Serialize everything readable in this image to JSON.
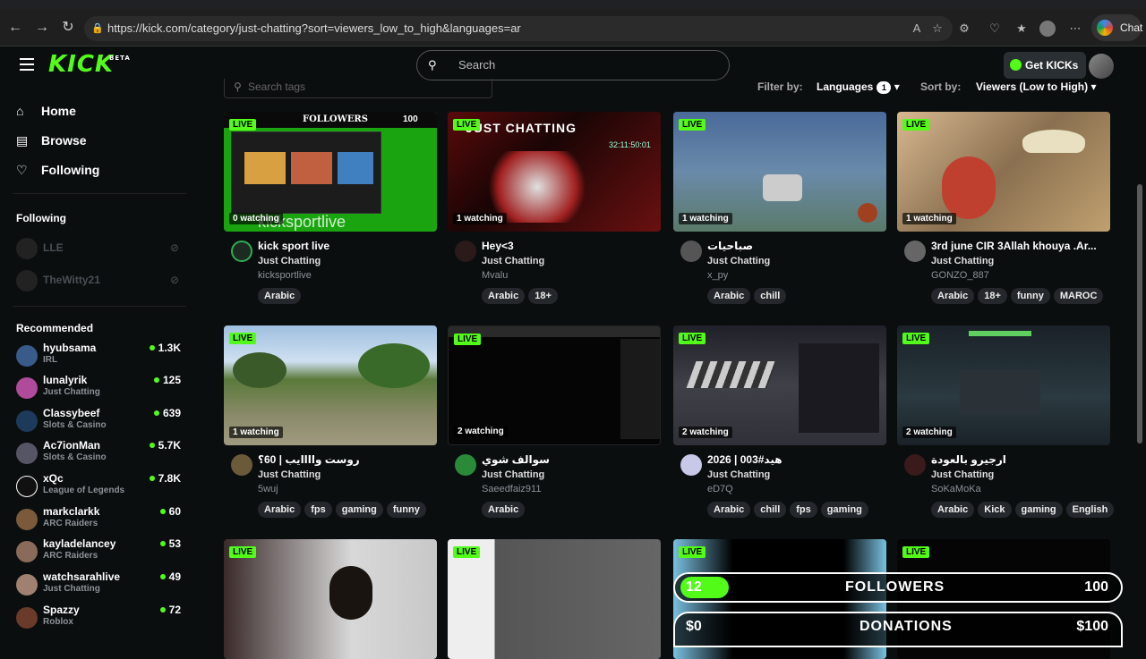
{
  "browser": {
    "url": "https://kick.com/category/just-chatting?sort=viewers_low_to_high&languages=ar",
    "chat_label": "Chat"
  },
  "header": {
    "logo": "KICK",
    "logo_beta": "BETA",
    "search_placeholder": "Search",
    "get_kicks": "Get KICKs"
  },
  "sidebar": {
    "nav": [
      "Home",
      "Browse",
      "Following"
    ],
    "following_title": "Following",
    "following": [
      "LLE",
      "TheWitty21"
    ],
    "recommended_title": "Recommended",
    "recommended": [
      {
        "name": "hyubsama",
        "cat": "IRL",
        "viewers": "1.3K"
      },
      {
        "name": "lunalyrik",
        "cat": "Just Chatting",
        "viewers": "125"
      },
      {
        "name": "Classybeef",
        "cat": "Slots & Casino",
        "viewers": "639"
      },
      {
        "name": "Ac7ionMan",
        "cat": "Slots & Casino",
        "viewers": "5.7K"
      },
      {
        "name": "xQc",
        "cat": "League of Legends",
        "viewers": "7.8K"
      },
      {
        "name": "markclarkk",
        "cat": "ARC Raiders",
        "viewers": "60"
      },
      {
        "name": "kayladelancey",
        "cat": "ARC Raiders",
        "viewers": "53"
      },
      {
        "name": "watchsarahlive",
        "cat": "Just Chatting",
        "viewers": "49"
      },
      {
        "name": "Spazzy",
        "cat": "Roblox",
        "viewers": "72"
      }
    ]
  },
  "filters": {
    "tag_search_placeholder": "Search tags",
    "filter_by": "Filter by:",
    "languages": "Languages",
    "languages_count": "1",
    "sort_by": "Sort by:",
    "sort_value": "Viewers (Low to High)"
  },
  "common": {
    "live": "LIVE"
  },
  "cards": [
    {
      "title": "kick sport live",
      "cat": "Just Chatting",
      "user": "kicksportlive",
      "watching": "0 watching",
      "tags": [
        "Arabic"
      ]
    },
    {
      "title": "Hey<3",
      "cat": "Just Chatting",
      "user": "Mvalu",
      "watching": "1 watching",
      "tags": [
        "Arabic",
        "18+"
      ]
    },
    {
      "title": "صباحيات",
      "cat": "Just Chatting",
      "user": "x_py",
      "watching": "1 watching",
      "tags": [
        "Arabic",
        "chill"
      ]
    },
    {
      "title": "3rd june CIR 3Allah khouya .Ar...",
      "cat": "Just Chatting",
      "user": "GONZO_887",
      "watching": "1 watching",
      "tags": [
        "Arabic",
        "18+",
        "funny",
        "MAROC"
      ]
    },
    {
      "title": "روست واااايب | 60؟",
      "cat": "Just Chatting",
      "user": "5wuj",
      "watching": "1 watching",
      "tags": [
        "Arabic",
        "fps",
        "gaming",
        "funny"
      ]
    },
    {
      "title": "سوالف شوي",
      "cat": "Just Chatting",
      "user": "Saeedfaiz911",
      "watching": "2 watching",
      "tags": [
        "Arabic"
      ]
    },
    {
      "title": "2026 | 003#هيد",
      "cat": "Just Chatting",
      "user": "eD7Q",
      "watching": "2 watching",
      "tags": [
        "Arabic",
        "chill",
        "fps",
        "gaming"
      ]
    },
    {
      "title": "ارجيرو بالعودة",
      "cat": "Just Chatting",
      "user": "SoKaMoKa",
      "watching": "2 watching",
      "tags": [
        "Arabic",
        "Kick",
        "gaming",
        "English"
      ]
    }
  ],
  "thumb_texts": {
    "followers_label": "FOLLOWERS",
    "followers_val": "100",
    "just_chatting": "JUST CHATTING",
    "clock": "32:11:50:01",
    "kicksport": "kicksportlive",
    "overlay_followers_n": "12",
    "overlay_followers": "FOLLOWERS",
    "overlay_followers_val": "100",
    "overlay_donations_n": "$0",
    "overlay_donations": "DONATIONS",
    "overlay_donations_val": "$100"
  }
}
